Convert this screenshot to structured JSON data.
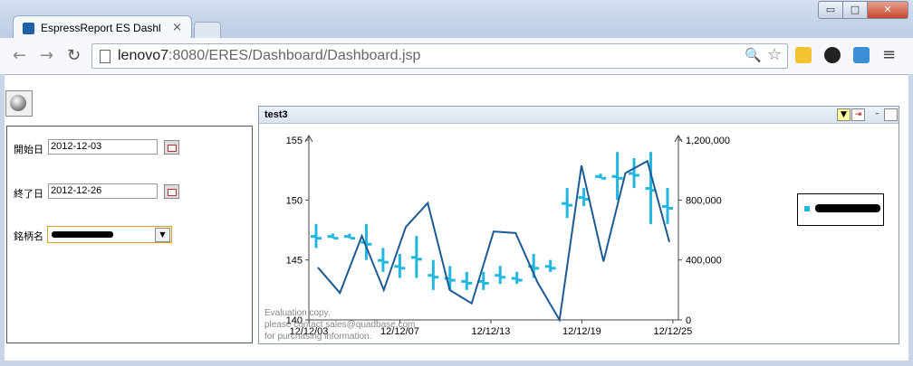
{
  "browser": {
    "tab_title": "EspressReport ES Dashl",
    "tab_close": "×",
    "url_host": "lenovo7",
    "url_rest": ":8080/ERES/Dashboard/Dashboard.jsp",
    "win_min": "▭",
    "win_max": "□",
    "win_close": "✕",
    "back": "←",
    "forward": "→",
    "reload": "↻",
    "zoom": "🔍",
    "star": "☆",
    "menu": "≡"
  },
  "params": {
    "start_label": "開始日",
    "start_value": "2012-12-03",
    "end_label": "終了日",
    "end_value": "2012-12-26",
    "issue_label": "銘柄名"
  },
  "chart_panel": {
    "title": "test3",
    "watermark": "Evaluation copy,\nplease contact sales@quadbase.com\nfor purchasing information."
  },
  "colors": {
    "bar": "#22b7e0",
    "line": "#1d5a93"
  },
  "chart_data": {
    "type": "line",
    "x_ticks": [
      "12/12/03",
      "12/12/07",
      "12/12/13",
      "12/12/19",
      "12/12/25"
    ],
    "y_left": {
      "range": [
        140,
        155
      ],
      "ticks": [
        "140",
        "145",
        "150",
        "155"
      ]
    },
    "y_right": {
      "range": [
        0,
        1200000
      ],
      "ticks": [
        "0",
        "400,000",
        "800,000",
        "1,200,000"
      ]
    },
    "grid": false,
    "legend_position": "right",
    "price_bars": [
      {
        "high": 148.0,
        "low": 146.0
      },
      {
        "high": 147.2,
        "low": 146.8
      },
      {
        "high": 147.2,
        "low": 146.8
      },
      {
        "high": 148.0,
        "low": 145.0
      },
      {
        "high": 146.0,
        "low": 144.0
      },
      {
        "high": 145.5,
        "low": 143.5
      },
      {
        "high": 147.0,
        "low": 143.5
      },
      {
        "high": 145.0,
        "low": 142.5
      },
      {
        "high": 144.5,
        "low": 142.5
      },
      {
        "high": 144.0,
        "low": 142.5
      },
      {
        "high": 144.0,
        "low": 142.5
      },
      {
        "high": 144.5,
        "low": 143.0
      },
      {
        "high": 144.0,
        "low": 143.0
      },
      {
        "high": 145.5,
        "low": 143.5
      },
      {
        "high": 145.0,
        "low": 144.0
      },
      {
        "high": 151.0,
        "low": 148.5
      },
      {
        "high": 151.0,
        "low": 149.5
      },
      {
        "high": 152.2,
        "low": 151.8
      },
      {
        "high": 154.0,
        "low": 150.0
      },
      {
        "high": 153.5,
        "low": 151.0
      },
      {
        "high": 154.0,
        "low": 148.0
      },
      {
        "high": 151.0,
        "low": 148.0
      }
    ],
    "volume": [
      350000,
      180000,
      560000,
      200000,
      620000,
      780000,
      200000,
      110000,
      590000,
      580000,
      250000,
      0,
      1030000,
      390000,
      980000,
      1060000,
      520000
    ]
  }
}
